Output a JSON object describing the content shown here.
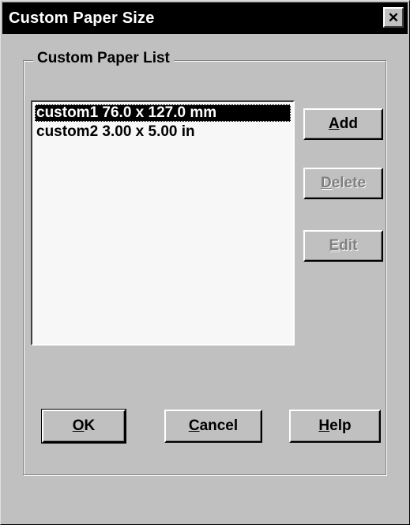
{
  "window": {
    "title": "Custom Paper Size",
    "close_glyph": "✕"
  },
  "group": {
    "label": "Custom Paper List"
  },
  "list": {
    "items": [
      {
        "label": "custom1 76.0 x 127.0 mm",
        "selected": true
      },
      {
        "label": "custom2 3.00 x 5.00 in",
        "selected": false
      }
    ]
  },
  "buttons": {
    "add": {
      "mnemonic": "A",
      "rest": "dd"
    },
    "delete": {
      "mnemonic": "D",
      "rest": "elete",
      "disabled": true
    },
    "edit": {
      "mnemonic": "E",
      "rest": "dit",
      "disabled": true
    },
    "ok": {
      "mnemonic": "O",
      "rest": "K"
    },
    "cancel": {
      "mnemonic": "C",
      "rest": "ancel"
    },
    "help": {
      "mnemonic": "H",
      "rest": "elp"
    }
  },
  "colors": {
    "face": "#c0c0c0",
    "titlebar": "#000000",
    "selection": "#000000",
    "list_bg": "#f7f7f7"
  }
}
